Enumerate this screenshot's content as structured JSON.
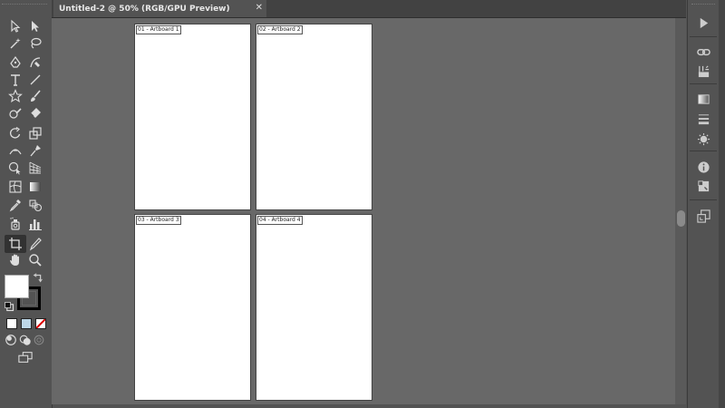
{
  "document_tab": {
    "title": "Untitled-2 @ 50% (RGB/GPU Preview)",
    "close_glyph": "✕"
  },
  "artboards": [
    {
      "label": "01 - Artboard 1"
    },
    {
      "label": "02 - Artboard 2"
    },
    {
      "label": "03 - Artboard 3"
    },
    {
      "label": "04 - Artboard 4"
    }
  ],
  "tools": [
    "selection-tool-icon",
    "direct-selection-tool-icon",
    "magic-wand-tool-icon",
    "lasso-tool-icon",
    "pen-tool-icon",
    "curvature-tool-icon",
    "type-tool-icon",
    "line-segment-tool-icon",
    "star-tool-icon",
    "paintbrush-tool-icon",
    "shaper-tool-icon",
    "eraser-tool-icon",
    "rotate-tool-icon",
    "scale-tool-icon",
    "width-tool-icon",
    "puppet-warp-tool-icon",
    "shape-builder-tool-icon",
    "perspective-grid-tool-icon",
    "mesh-tool-icon",
    "gradient-tool-icon",
    "eyedropper-tool-icon",
    "blend-tool-icon",
    "symbol-sprayer-tool-icon",
    "column-graph-tool-icon",
    "artboard-tool-icon",
    "slice-tool-icon",
    "hand-tool-icon",
    "zoom-tool-icon"
  ],
  "colors": {
    "fill": "#ffffff",
    "stroke": "#000000",
    "ui_background": "#535353",
    "canvas_background": "#686868"
  },
  "right_panel": [
    "play-icon",
    "links-icon",
    "libraries-icon",
    "gradient-panel-icon",
    "stroke-panel-icon",
    "appearance-icon",
    "info-icon",
    "transform-icon",
    "artboards-panel-icon"
  ]
}
